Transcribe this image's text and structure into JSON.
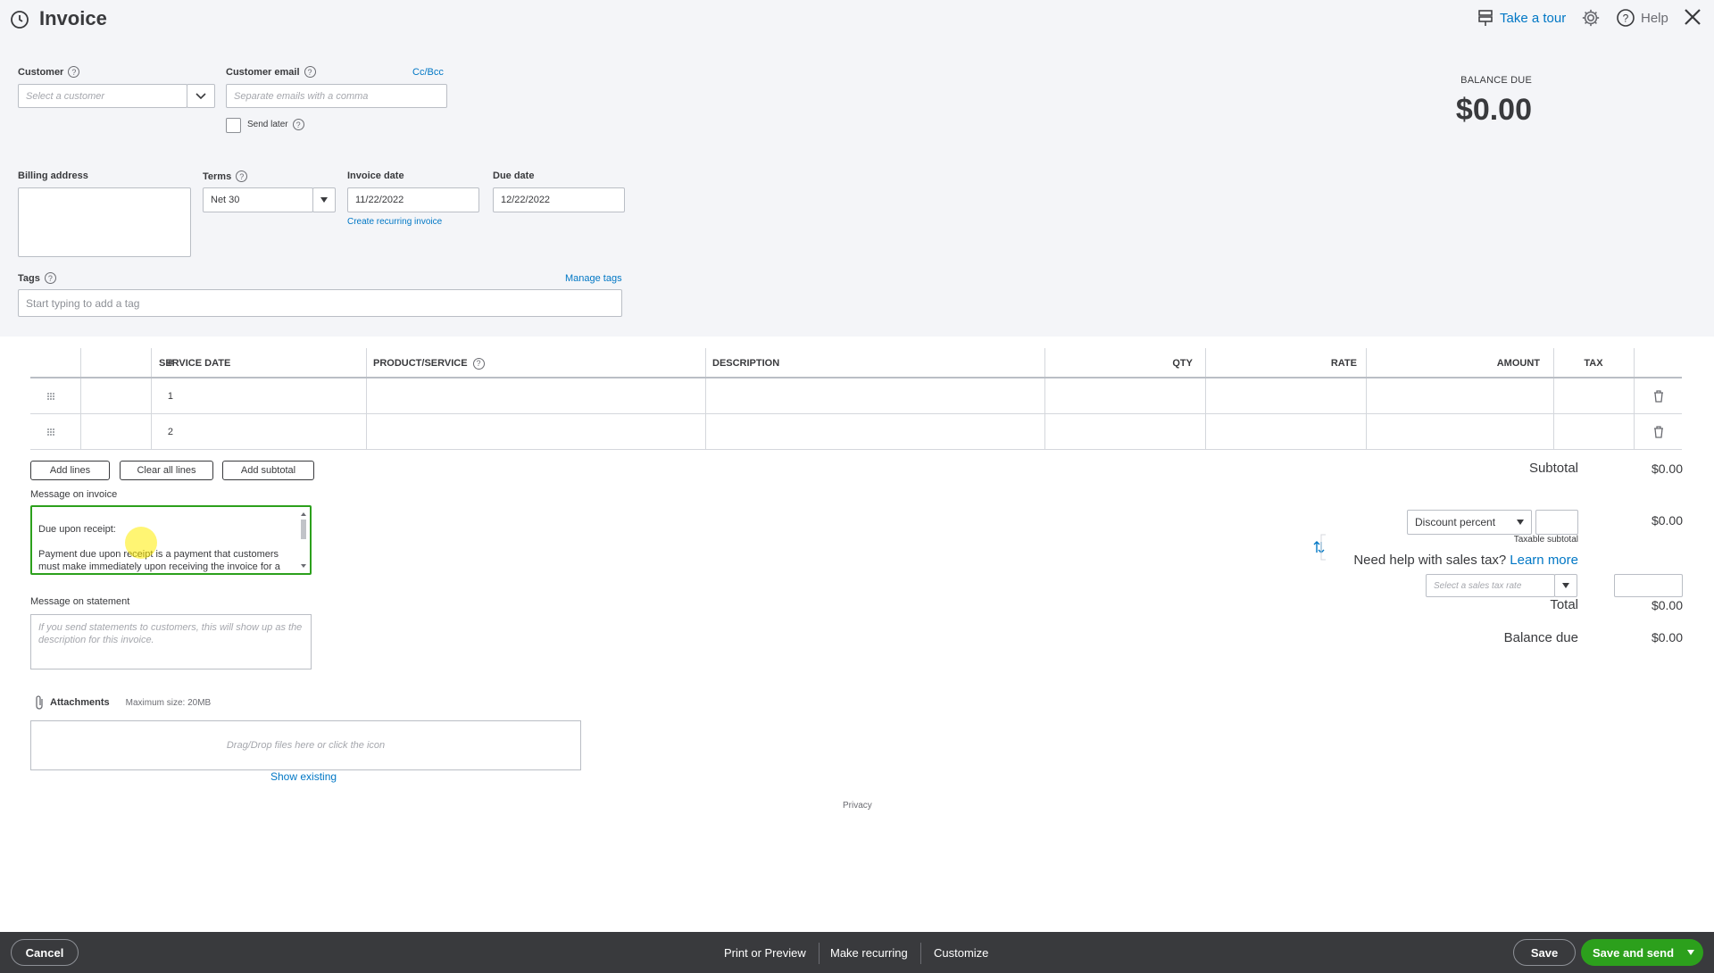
{
  "header": {
    "title": "Invoice",
    "take_tour": "Take a tour",
    "help": "Help"
  },
  "customer": {
    "label": "Customer",
    "placeholder": "Select a customer"
  },
  "email": {
    "label": "Customer email",
    "placeholder": "Separate emails with a comma",
    "cc_bcc": "Cc/Bcc",
    "send_later": "Send later"
  },
  "balance": {
    "label": "BALANCE DUE",
    "value": "$0.00"
  },
  "billing": {
    "label": "Billing address"
  },
  "terms": {
    "label": "Terms",
    "value": "Net 30"
  },
  "invoice_date": {
    "label": "Invoice date",
    "value": "11/22/2022",
    "recurring_link": "Create recurring invoice"
  },
  "due_date": {
    "label": "Due date",
    "value": "12/22/2022"
  },
  "tags": {
    "label": "Tags",
    "manage": "Manage tags",
    "placeholder": "Start typing to add a tag"
  },
  "table": {
    "headers": {
      "num": "#",
      "service_date": "SERVICE DATE",
      "product": "PRODUCT/SERVICE",
      "description": "DESCRIPTION",
      "qty": "QTY",
      "rate": "RATE",
      "amount": "AMOUNT",
      "tax": "TAX"
    },
    "rows": [
      {
        "num": "1"
      },
      {
        "num": "2"
      }
    ],
    "add_lines": "Add lines",
    "clear_lines": "Clear all lines",
    "add_subtotal": "Add subtotal"
  },
  "message_invoice": {
    "label": "Message on invoice",
    "text": "Due upon receipt:\n\nPayment due upon receipt is a payment that customers must make immediately upon receiving the invoice for a transaction. Typically, businesses"
  },
  "message_statement": {
    "label": "Message on statement",
    "placeholder": "If you send statements to customers, this will show up as the description for this invoice."
  },
  "attachments": {
    "label": "Attachments",
    "max_size": "Maximum size: 20MB",
    "drop_text": "Drag/Drop files here or click the icon",
    "show_existing": "Show existing"
  },
  "privacy": "Privacy",
  "totals": {
    "subtotal_label": "Subtotal",
    "subtotal_value": "$0.00",
    "discount_select": "Discount percent",
    "discount_value": "$0.00",
    "taxable_subtotal": "Taxable subtotal",
    "sales_tax_help": "Need help with sales tax?",
    "learn_more": "Learn more",
    "tax_rate_placeholder": "Select a sales tax rate",
    "total_label": "Total",
    "total_value": "$0.00",
    "balance_due_label": "Balance due",
    "balance_due_value": "$0.00"
  },
  "footer": {
    "cancel": "Cancel",
    "print_preview": "Print or Preview",
    "make_recurring": "Make recurring",
    "customize": "Customize",
    "save": "Save",
    "save_and_send": "Save and send"
  },
  "colors": {
    "brand_green": "#2ca01c",
    "link_blue": "#0077c5",
    "footer_bg": "#393a3d"
  }
}
